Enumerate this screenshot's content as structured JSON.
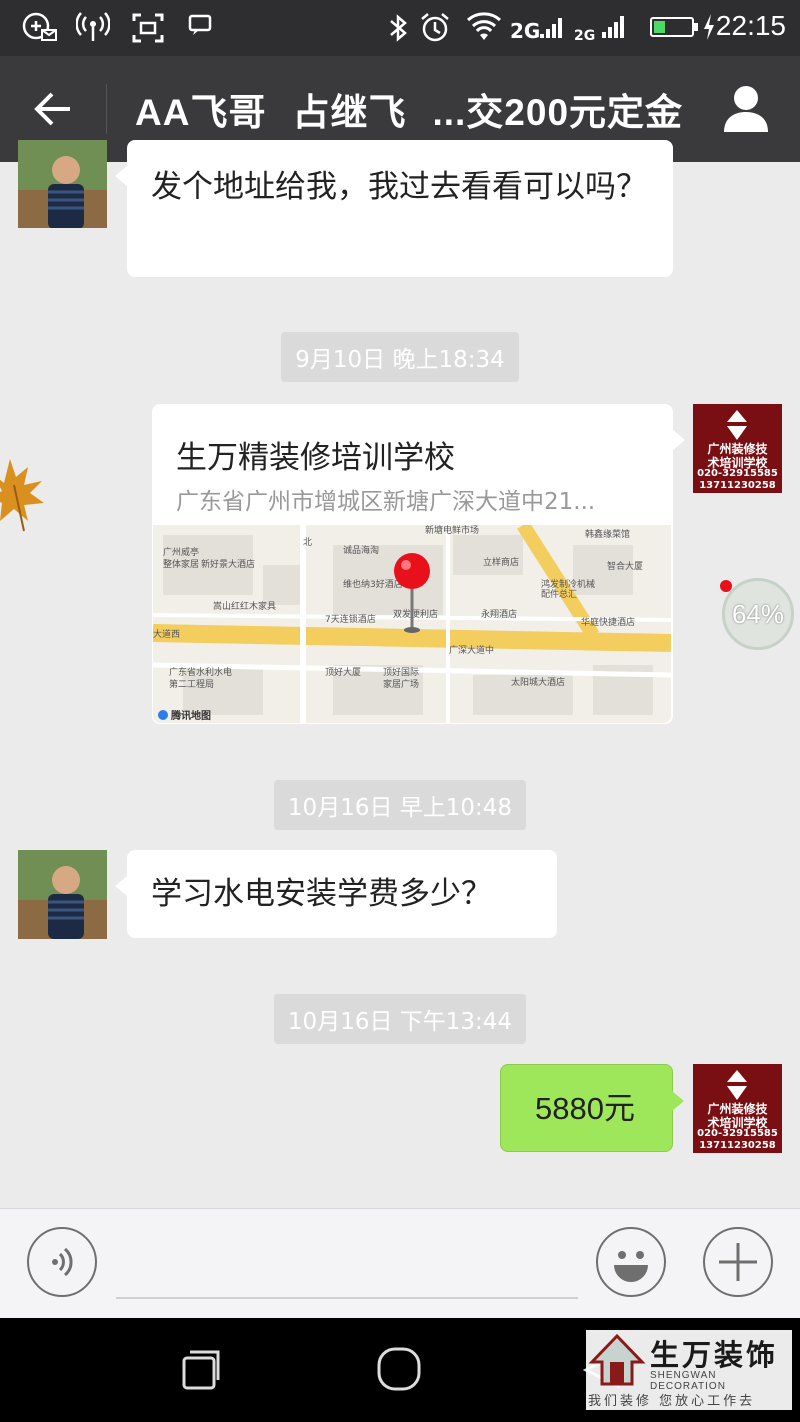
{
  "status_bar": {
    "time": "22:15",
    "battery_level": 0.3,
    "network": "2G",
    "icons": [
      "notification-icon",
      "hotspot-icon",
      "screenshot-icon",
      "message-icon",
      "bluetooth-icon",
      "alarm-icon",
      "wifi-icon",
      "signal-icon",
      "battery-icon"
    ]
  },
  "header": {
    "title_parts": [
      "AA飞哥",
      "占继飞",
      "...交200元定金"
    ],
    "back_icon": "back-arrow-icon",
    "profile_icon": "person-icon"
  },
  "messages": {
    "m1": {
      "text": "发个地址给我，我过去看看可以吗？"
    },
    "ts1": "9月10日 晚上18:34",
    "location": {
      "title": "生万精装修培训学校",
      "address": "广东省广州市增城区新塘广深大道中21...",
      "map_labels": [
        "北",
        "诚品海淘",
        "新塘电鲜市场",
        "立样商店",
        "广州威亭",
        "整体家居",
        "新好景大酒店",
        "维也纳3好酒店",
        "鸿发制冷机械",
        "配件总汇",
        "嵩山红红木家具",
        "7天连锁酒店",
        "双发便利店",
        "永翔酒店",
        "华庭快捷酒店",
        "大道西",
        "广深大道中",
        "广东省水利水电",
        "第二工程局",
        "顶好大厦",
        "顶好国际",
        "家居广场",
        "太阳城大酒店",
        "智合大厦",
        "韩鑫缘菜馆",
        "腾讯地图"
      ]
    },
    "ts2": "10月16日 早上10:48",
    "m2": {
      "text": "学习水电安装学费多少？"
    },
    "ts3": "10月16日 下午13:44",
    "m3": {
      "text": "5880元"
    },
    "upload_progress": "64%"
  },
  "school_logo": {
    "line1": "广州装修技",
    "line2": "术培训学校",
    "phone1": "020-32915585",
    "phone2": "13711230258"
  },
  "input_bar": {
    "voice_icon": "voice-icon",
    "emoji_icon": "emoji-icon",
    "plus_icon": "plus-icon"
  },
  "nav_bar": {
    "icons": [
      "back-triangle-icon",
      "home-circle-icon",
      "recents-square-icon"
    ]
  },
  "watermark": {
    "brand": "生万装饰",
    "english": "SHENGWAN DECORATION",
    "slogan": "我们装修 您放心工作去"
  }
}
